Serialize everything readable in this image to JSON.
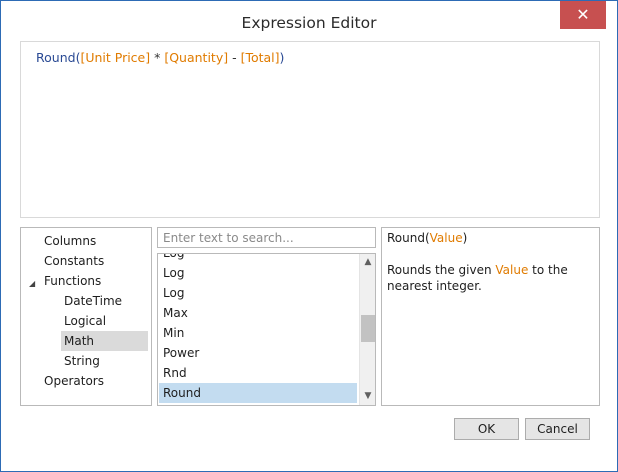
{
  "window": {
    "title": "Expression Editor",
    "close_glyph": "✕"
  },
  "expression": {
    "parts": [
      {
        "text": "Round",
        "kind": "fn"
      },
      {
        "text": "(",
        "kind": "fn"
      },
      {
        "text": "[Unit Price]",
        "kind": "fld"
      },
      {
        "text": " * ",
        "kind": "op"
      },
      {
        "text": "[Quantity]",
        "kind": "fld"
      },
      {
        "text": " - ",
        "kind": "op"
      },
      {
        "text": "[Total]",
        "kind": "fld"
      },
      {
        "text": ")",
        "kind": "fn"
      }
    ]
  },
  "categories": {
    "items": [
      {
        "label": "Columns"
      },
      {
        "label": "Constants"
      },
      {
        "label": "Functions",
        "expanded": true
      },
      {
        "label": "DateTime"
      },
      {
        "label": "Logical"
      },
      {
        "label": "Math",
        "selected": true
      },
      {
        "label": "String"
      },
      {
        "label": "Operators"
      }
    ],
    "expand_glyph": "◢"
  },
  "search": {
    "placeholder": "Enter text to search...",
    "value": ""
  },
  "functions": {
    "items": [
      "Log",
      "Log",
      "Log",
      "Max",
      "Min",
      "Power",
      "Rnd",
      "Round"
    ],
    "selected": "Round",
    "scroll_up_glyph": "▲",
    "scroll_down_glyph": "▼"
  },
  "description": {
    "sig_name": "Round",
    "sig_open": "(",
    "sig_param": "Value",
    "sig_close": ")",
    "body_pre": "Rounds the given ",
    "body_param": "Value",
    "body_post": " to the nearest integer."
  },
  "buttons": {
    "ok": "OK",
    "cancel": "Cancel"
  },
  "colors": {
    "accent": "#2d6bb5",
    "close": "#c75050",
    "field": "#e07b00",
    "function": "#2a4a94",
    "selection": "#c3dcf0"
  }
}
